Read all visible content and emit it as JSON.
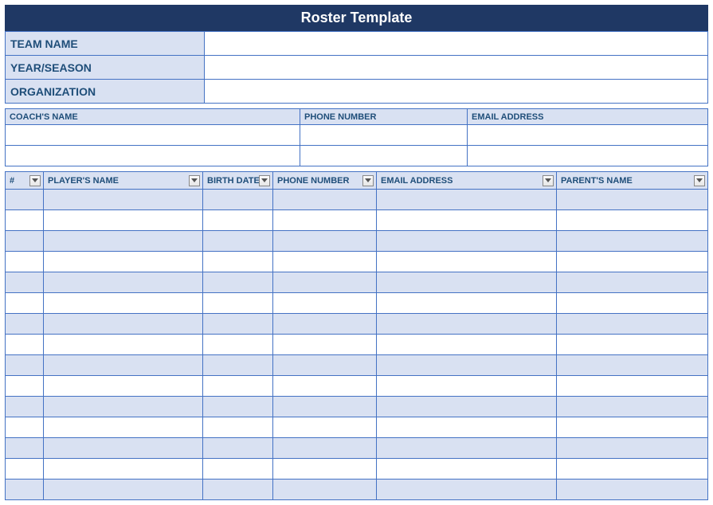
{
  "title": "Roster Template",
  "info": {
    "team_name_label": "TEAM NAME",
    "team_name_value": "",
    "year_season_label": "YEAR/SEASON",
    "year_season_value": "",
    "organization_label": "ORGANIZATION",
    "organization_value": ""
  },
  "coach": {
    "headers": {
      "name": "COACH'S NAME",
      "phone": "PHONE NUMBER",
      "email": "EMAIL ADDRESS"
    },
    "rows": [
      {
        "name": "",
        "phone": "",
        "email": ""
      },
      {
        "name": "",
        "phone": "",
        "email": ""
      }
    ]
  },
  "roster": {
    "headers": {
      "num": "#",
      "name": "PLAYER'S NAME",
      "birth": "BIRTH DATE",
      "phone": "PHONE NUMBER",
      "email": "EMAIL ADDRESS",
      "parent": "PARENT'S NAME"
    },
    "rows": [
      {
        "num": "",
        "name": "",
        "birth": "",
        "phone": "",
        "email": "",
        "parent": ""
      },
      {
        "num": "",
        "name": "",
        "birth": "",
        "phone": "",
        "email": "",
        "parent": ""
      },
      {
        "num": "",
        "name": "",
        "birth": "",
        "phone": "",
        "email": "",
        "parent": ""
      },
      {
        "num": "",
        "name": "",
        "birth": "",
        "phone": "",
        "email": "",
        "parent": ""
      },
      {
        "num": "",
        "name": "",
        "birth": "",
        "phone": "",
        "email": "",
        "parent": ""
      },
      {
        "num": "",
        "name": "",
        "birth": "",
        "phone": "",
        "email": "",
        "parent": ""
      },
      {
        "num": "",
        "name": "",
        "birth": "",
        "phone": "",
        "email": "",
        "parent": ""
      },
      {
        "num": "",
        "name": "",
        "birth": "",
        "phone": "",
        "email": "",
        "parent": ""
      },
      {
        "num": "",
        "name": "",
        "birth": "",
        "phone": "",
        "email": "",
        "parent": ""
      },
      {
        "num": "",
        "name": "",
        "birth": "",
        "phone": "",
        "email": "",
        "parent": ""
      },
      {
        "num": "",
        "name": "",
        "birth": "",
        "phone": "",
        "email": "",
        "parent": ""
      },
      {
        "num": "",
        "name": "",
        "birth": "",
        "phone": "",
        "email": "",
        "parent": ""
      },
      {
        "num": "",
        "name": "",
        "birth": "",
        "phone": "",
        "email": "",
        "parent": ""
      },
      {
        "num": "",
        "name": "",
        "birth": "",
        "phone": "",
        "email": "",
        "parent": ""
      },
      {
        "num": "",
        "name": "",
        "birth": "",
        "phone": "",
        "email": "",
        "parent": ""
      }
    ]
  }
}
